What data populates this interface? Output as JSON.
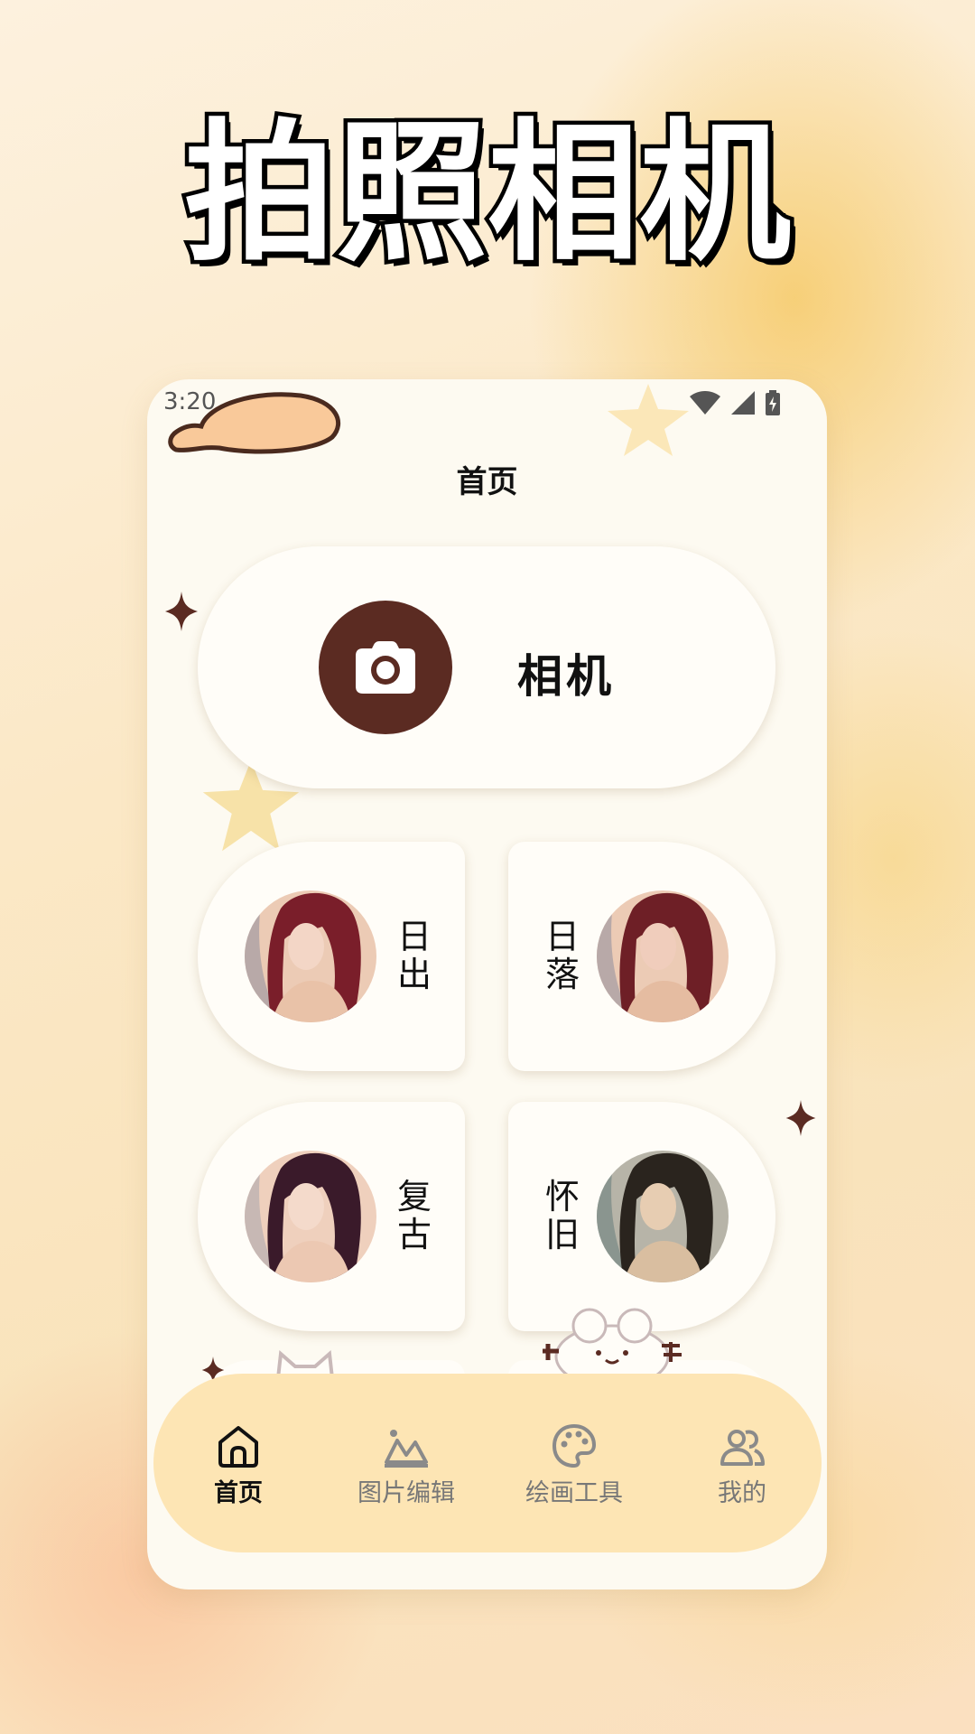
{
  "headline": "拍照相机",
  "status_bar": {
    "time": "3:20",
    "icons": [
      "wifi-icon",
      "signal-icon",
      "battery-icon"
    ]
  },
  "page_title": "首页",
  "camera_button": {
    "label": "相机",
    "icon": "camera-icon"
  },
  "filters": [
    {
      "label": "日出",
      "icon": "portrait-image"
    },
    {
      "label": "日落",
      "icon": "portrait-image"
    },
    {
      "label": "复古",
      "icon": "portrait-image"
    },
    {
      "label": "怀旧",
      "icon": "portrait-image"
    }
  ],
  "tab_bar": {
    "tabs": [
      {
        "label": "首页",
        "icon": "home-icon",
        "active": true
      },
      {
        "label": "图片编辑",
        "icon": "image-edit-icon",
        "active": false
      },
      {
        "label": "绘画工具",
        "icon": "palette-icon",
        "active": false
      },
      {
        "label": "我的",
        "icon": "users-icon",
        "active": false
      }
    ]
  },
  "colors": {
    "accent": "#5b2b22",
    "tab_bar_bg": "#fde5b4",
    "card_bg": "#fffdf8",
    "panel_bg": "#fdfaf1"
  }
}
